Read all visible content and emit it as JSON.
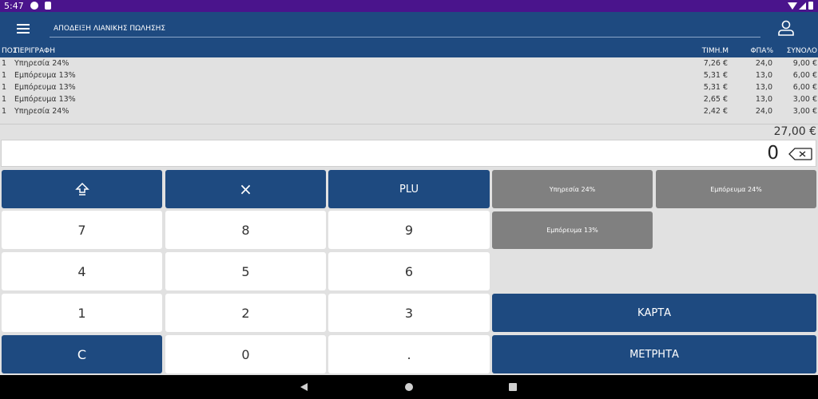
{
  "status_bar": {
    "time": "5:47"
  },
  "app_bar": {
    "title": "ΑΠΟΔΕΙΞΗ ΛΙΑΝΙΚΗΣ ΠΩΛΗΣΗΣ"
  },
  "table": {
    "headers": {
      "pos": "ΠΟΣ",
      "desc": "ΠΕΡΙΓΡΑΦΗ",
      "price": "ΤΙΜΗ.Μ",
      "vat": "ΦΠΑ%",
      "total": "ΣΥΝΟΛΟ"
    },
    "rows": [
      {
        "pos": "1",
        "desc": "Υπηρεσία 24%",
        "price": "7,26 €",
        "vat": "24,0",
        "total": "9,00 €"
      },
      {
        "pos": "1",
        "desc": "Εμπόρευμα 13%",
        "price": "5,31 €",
        "vat": "13,0",
        "total": "6,00 €"
      },
      {
        "pos": "1",
        "desc": "Εμπόρευμα 13%",
        "price": "5,31 €",
        "vat": "13,0",
        "total": "6,00 €"
      },
      {
        "pos": "1",
        "desc": "Εμπόρευμα 13%",
        "price": "2,65 €",
        "vat": "13,0",
        "total": "3,00 €"
      },
      {
        "pos": "1",
        "desc": "Υπηρεσία 24%",
        "price": "2,42 €",
        "vat": "24,0",
        "total": "3,00 €"
      }
    ],
    "grand_total": "27,00 €"
  },
  "display": {
    "amount": "0"
  },
  "keypad": {
    "multiply": "×",
    "plu": "PLU",
    "digits": {
      "d7": "7",
      "d8": "8",
      "d9": "9",
      "d4": "4",
      "d5": "5",
      "d6": "6",
      "d1": "1",
      "d2": "2",
      "d3": "3",
      "d0": "0"
    },
    "clear": "C",
    "dot": "."
  },
  "quick_items": {
    "service24": "Υπηρεσία 24%",
    "goods24": "Εμπόρευμα 24%",
    "goods13": "Εμπόρευμα 13%"
  },
  "payment": {
    "card": "ΚΑΡΤΑ",
    "cash": "ΜΕΤΡΗΤΑ"
  },
  "colors": {
    "primary": "#1e4a80",
    "status_bar": "#4a148c",
    "quick_item": "#808080"
  }
}
